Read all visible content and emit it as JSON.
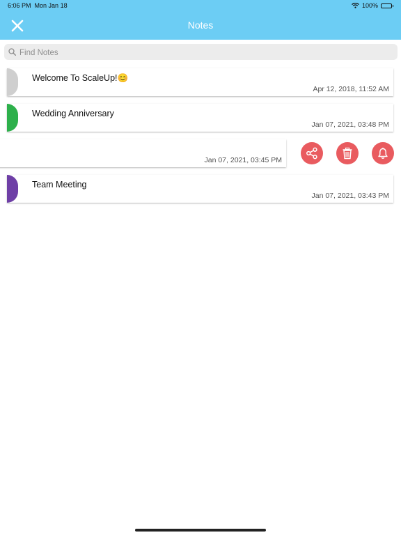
{
  "status_bar": {
    "time": "6:06 PM",
    "date": "Mon Jan 18",
    "battery": "100%",
    "wifi_icon": "wifi-icon",
    "battery_icon": "battery-icon"
  },
  "header": {
    "title": "Notes",
    "close_icon": "close-icon",
    "background_color": "#6ccdf4"
  },
  "search": {
    "placeholder": "Find Notes",
    "value": "",
    "icon": "search-icon"
  },
  "notes": [
    {
      "title": "Welcome To ScaleUp!😊",
      "date": "Apr 12, 2018, 11:52 AM",
      "color": "#cfcfcf"
    },
    {
      "title": "Wedding Anniversary",
      "date": "Jan 07, 2021, 03:48 PM",
      "color": "#2db04b"
    },
    {
      "title": "",
      "date": "Jan 07, 2021, 03:45 PM",
      "color": "#ffffff"
    },
    {
      "title": "Team Meeting",
      "date": "Jan 07, 2021, 03:43 PM",
      "color": "#6e3fa6"
    }
  ],
  "swipe_actions": [
    {
      "icon": "share-icon"
    },
    {
      "icon": "trash-icon"
    },
    {
      "icon": "bell-icon"
    }
  ],
  "colors": {
    "action": "#e95b5f"
  }
}
